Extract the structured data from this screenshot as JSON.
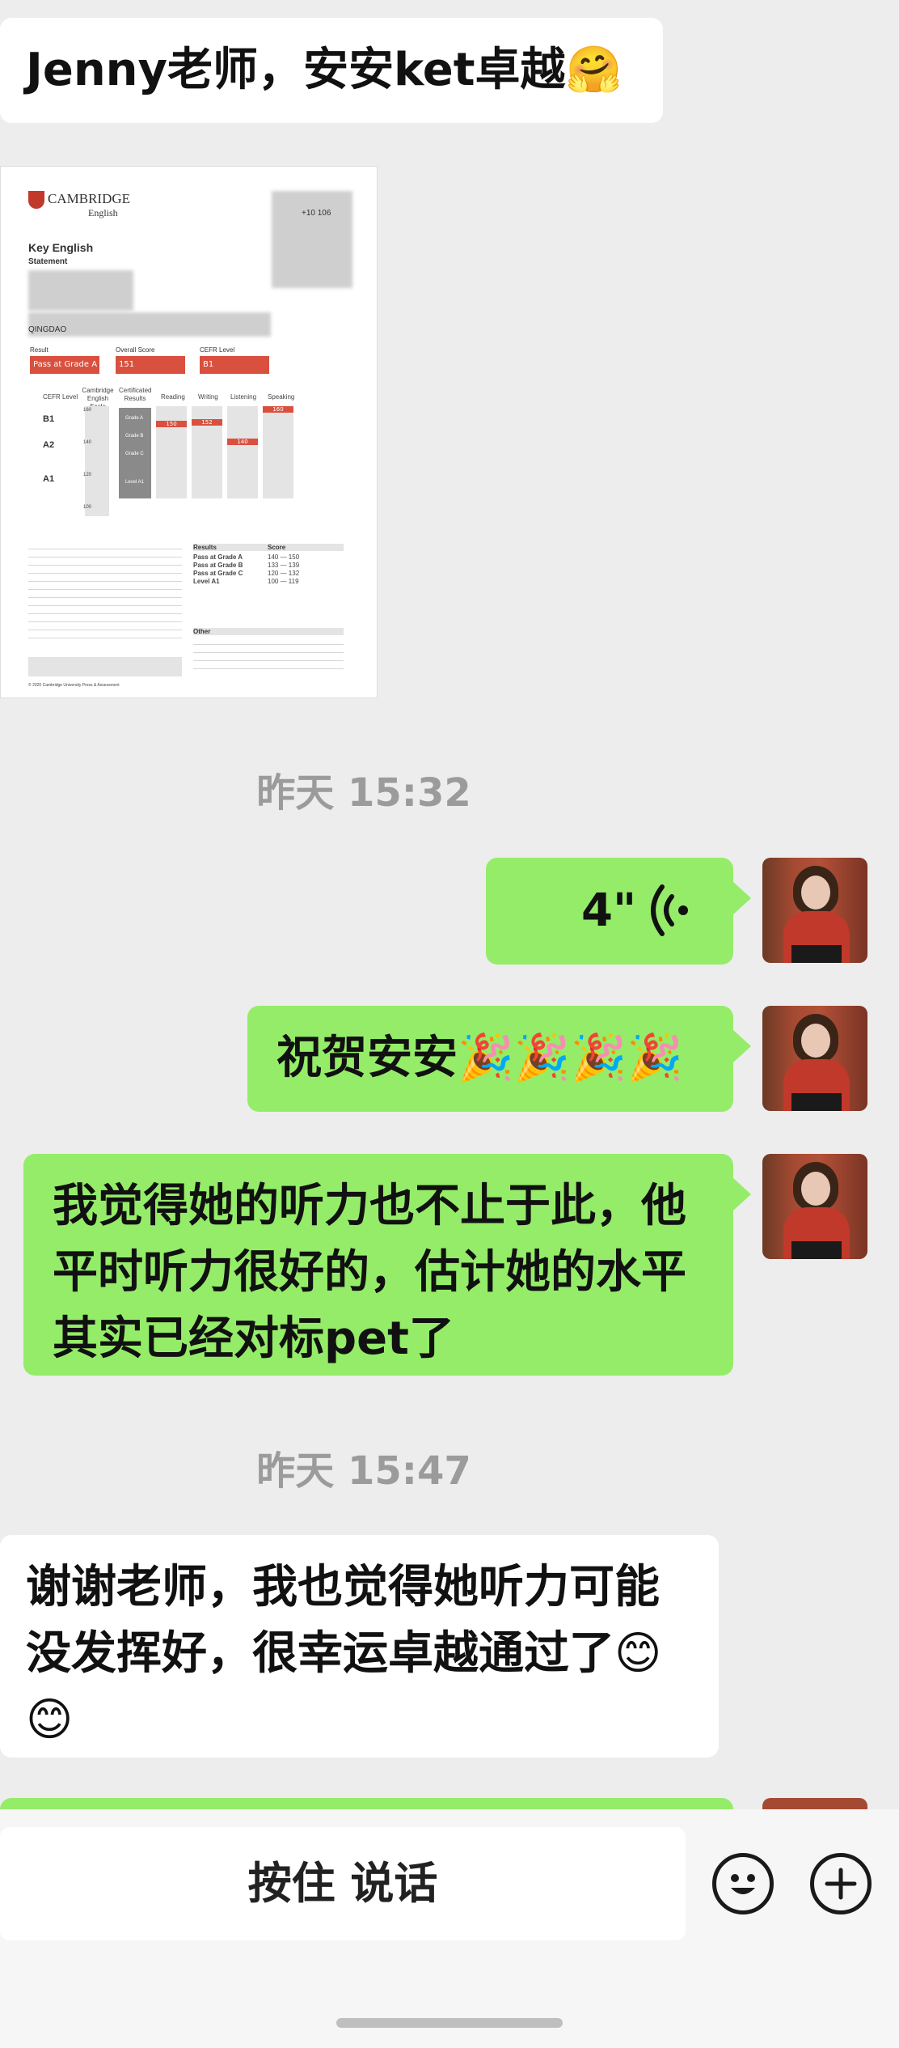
{
  "messages": {
    "m1": {
      "text": "Jenny老师，安安ket卓越",
      "emoji": "🤗"
    },
    "ts1": "昨天 15:32",
    "voice": {
      "duration": "4\""
    },
    "m3": {
      "text": "祝贺安安",
      "emoji": "🎉🎉🎉🎉"
    },
    "m4": {
      "text": "我觉得她的听力也不止于此，他平时听力很好的，估计她的水平其实已经对标pet了"
    },
    "ts2": "昨天 15:47",
    "m5": {
      "text": "谢谢老师，我也觉得她听力可能没发挥好，很幸运卓越通过了",
      "emoji": "😊😊"
    }
  },
  "certificate": {
    "brand": "CAMBRIDGE",
    "brand_sub": "English",
    "title": "Key English",
    "statement": "Statement",
    "city": "QINGDAO",
    "candidate_no": "+10 106",
    "result_label": "Result",
    "overall_label": "Overall Score",
    "cefr_label": "CEFR Level",
    "result_value": "Pass at Grade A",
    "overall_value": "151",
    "cefr_value": "B1",
    "columns": [
      "CEFR Level",
      "Cambridge English Scale",
      "Certificated Results",
      "Reading",
      "Writing",
      "Listening",
      "Speaking"
    ],
    "levels": [
      "B1",
      "A2",
      "A1"
    ],
    "grades": [
      "Grade A",
      "Grade B",
      "Grade C",
      "Level A1"
    ],
    "scale_ticks": [
      "160",
      "150",
      "140",
      "130",
      "120",
      "110",
      "100",
      "90"
    ],
    "skill_scores": {
      "reading": "150",
      "writing": "152",
      "listening": "140",
      "speaking": "160"
    },
    "score_table_header": [
      "Results",
      "Score"
    ],
    "score_table": [
      [
        "Pass at Grade A",
        "140 — 150"
      ],
      [
        "Pass at Grade B",
        "133 — 139"
      ],
      [
        "Pass at Grade C",
        "120 — 132"
      ],
      [
        "Level A1",
        "100 — 119"
      ]
    ],
    "other_label": "Other",
    "copyright": "© 2020 Cambridge University Press & Assessment"
  },
  "input": {
    "hold_to_talk": "按住 说话"
  },
  "colors": {
    "sent_bubble": "#95ec69",
    "received_bubble": "#ffffff",
    "background": "#ededed"
  }
}
